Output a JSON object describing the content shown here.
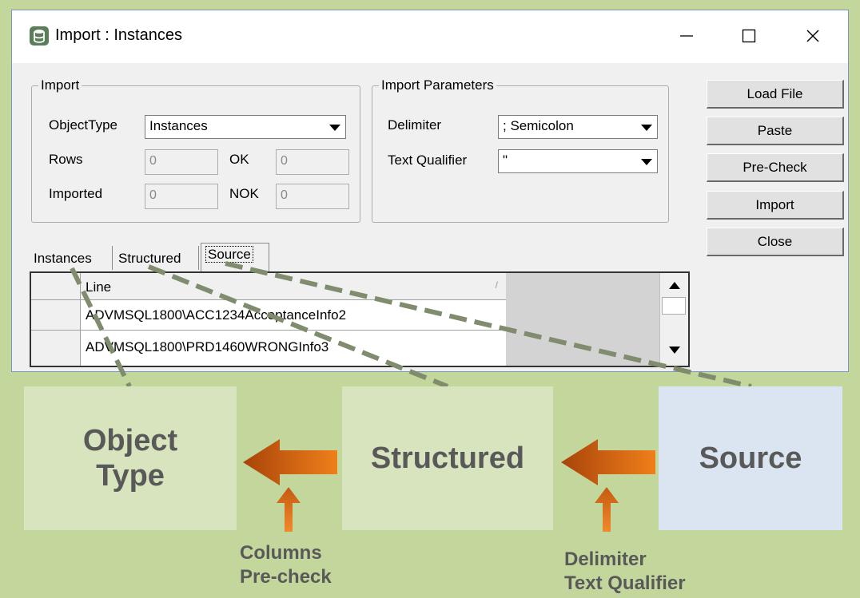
{
  "window": {
    "title": "Import : Instances",
    "controls": {
      "minimize": "—",
      "maximize": "☐",
      "close": "✕"
    }
  },
  "import_group": {
    "legend": "Import",
    "object_type_label": "ObjectType",
    "object_type_value": "Instances",
    "rows_label": "Rows",
    "rows_value": "0",
    "ok_label": "OK",
    "ok_value": "0",
    "imported_label": "Imported",
    "imported_value": "0",
    "nok_label": "NOK",
    "nok_value": "0"
  },
  "params_group": {
    "legend": "Import Parameters",
    "delimiter_label": "Delimiter",
    "delimiter_value": "; Semicolon",
    "qualifier_label": "Text Qualifier",
    "qualifier_value": "\""
  },
  "buttons": {
    "load_file": "Load File",
    "paste": "Paste",
    "pre_check": "Pre-Check",
    "import": "Import",
    "close": "Close"
  },
  "tabs": [
    {
      "label": "Instances"
    },
    {
      "label": "Structured"
    },
    {
      "label": "Source",
      "selected": true
    }
  ],
  "grid": {
    "column_header": "Line",
    "rows": [
      "ADVMSQL1800\\ACC1234AcceptanceInfo2",
      "ADVMSQL1800\\PRD1460WRONGInfo3"
    ]
  },
  "diagram": {
    "stage_object_type": "Object\nType",
    "stage_structured": "Structured",
    "stage_source": "Source",
    "caption_left_line1": "Columns",
    "caption_left_line2": "Pre-check",
    "caption_right_line1": "Delimiter",
    "caption_right_line2": "Text Qualifier"
  },
  "colors": {
    "background": "#c3d69b",
    "stage_green": "#d7e4bd",
    "stage_blue": "#dbe5f1",
    "arrow_orange": "#e46c0a",
    "dash_line": "#7f8c6e",
    "text_gray": "#595959"
  },
  "icons": [
    "database-icon",
    "minimize-icon",
    "maximize-icon",
    "close-icon",
    "dropdown-arrow-icon",
    "scroll-up-icon",
    "scroll-down-icon",
    "left-arrow-icon",
    "up-arrow-icon"
  ]
}
